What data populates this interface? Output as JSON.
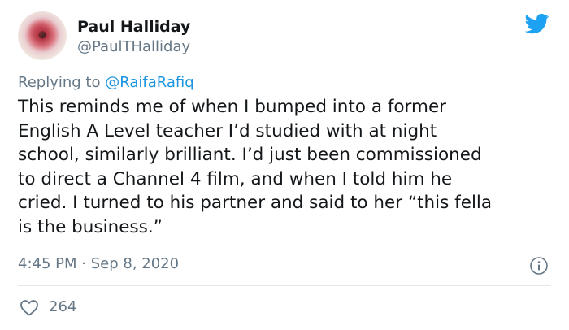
{
  "author": {
    "name": "Paul Halliday",
    "handle": "@PaulTHalliday"
  },
  "reply": {
    "prefix": "Replying to",
    "mention": "@RaifaRafiq"
  },
  "tweet": {
    "lines": [
      "This reminds me of when I bumped into a former",
      "English A Level teacher I’d studied with at night",
      "school, similarly brilliant. I’d just been commissioned",
      "to direct a Channel 4 film, and when I told him he",
      "cried. I turned to his partner and said to her “this fella",
      "is the business.”"
    ]
  },
  "meta": {
    "time": "4:45 PM",
    "separator": "·",
    "date": "Sep 8, 2020"
  },
  "engagement": {
    "likes": "264"
  },
  "icons": {
    "brand": "twitter-bird-icon",
    "info": "info-icon",
    "like": "heart-icon"
  },
  "colors": {
    "brand_blue": "#1da1f2",
    "link_blue": "#1b95e0",
    "secondary_text": "#657786",
    "primary_text": "#14171a",
    "divider": "#e1e8ed"
  }
}
